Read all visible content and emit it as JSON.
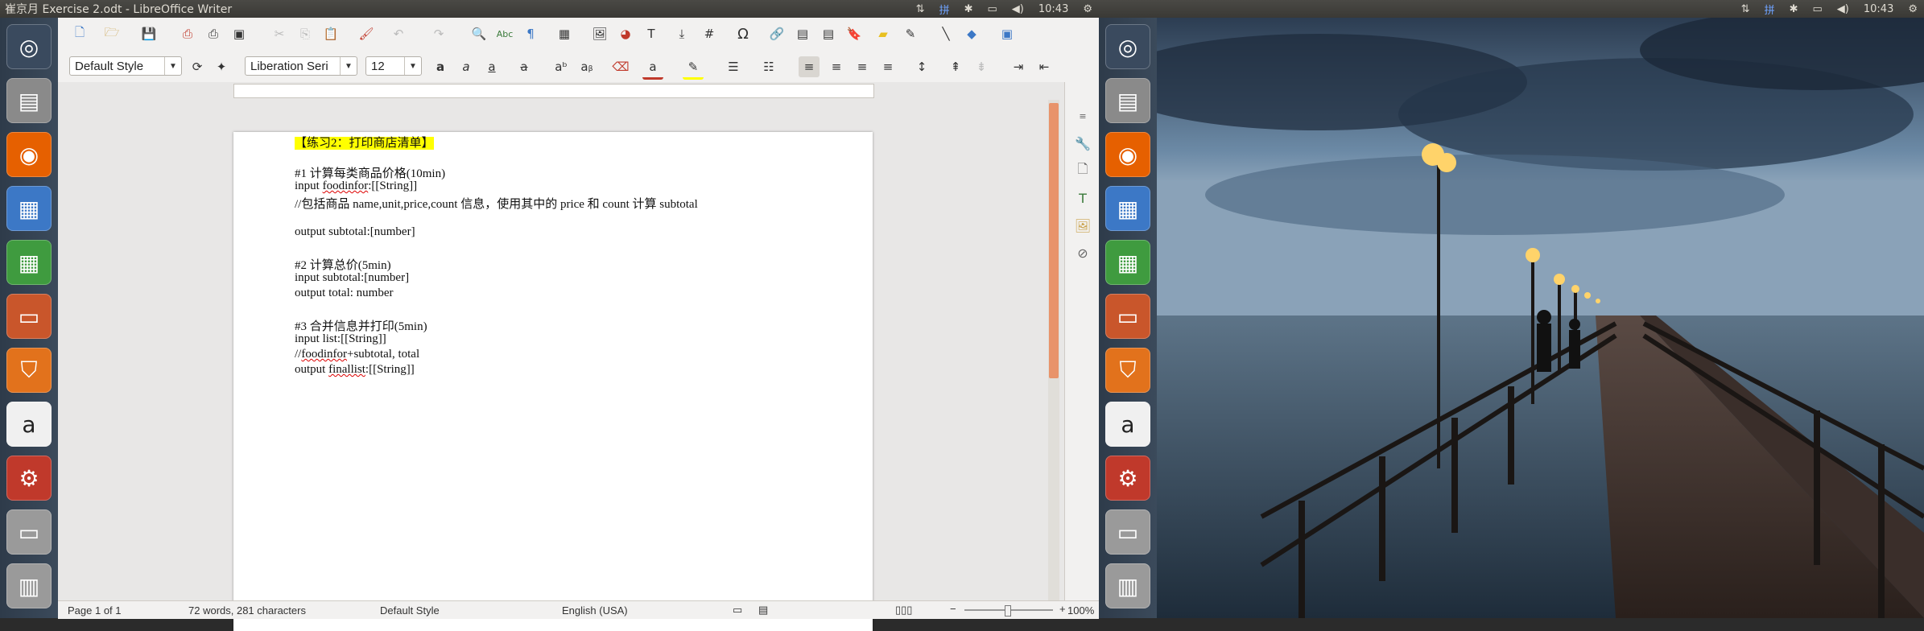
{
  "window": {
    "title": "崔京月 Exercise 2.odt - LibreOffice Writer"
  },
  "tray": {
    "time": "10:43"
  },
  "launcher": {
    "items": [
      {
        "name": "ubuntu-logo-icon",
        "glyph": "◎",
        "color": "#3a4a5e"
      },
      {
        "name": "files-icon",
        "glyph": "▤",
        "color": "#8a8a8a"
      },
      {
        "name": "firefox-icon",
        "glyph": "◉",
        "color": "#e66000"
      },
      {
        "name": "writer-icon",
        "glyph": "▦",
        "color": "#3c78c6"
      },
      {
        "name": "calc-icon",
        "glyph": "▦",
        "color": "#3f9b3f"
      },
      {
        "name": "impress-icon",
        "glyph": "▭",
        "color": "#c9562b"
      },
      {
        "name": "software-center-icon",
        "glyph": "⛉",
        "color": "#e2721c"
      },
      {
        "name": "amazon-icon",
        "glyph": "a",
        "color": "#f0f0f0"
      },
      {
        "name": "system-settings-icon",
        "glyph": "⚙",
        "color": "#c0392b"
      },
      {
        "name": "drive-icon",
        "glyph": "▭",
        "color": "#9a9a9a"
      },
      {
        "name": "trash-icon",
        "glyph": "▥",
        "color": "#9a9a9a"
      }
    ]
  },
  "formatting": {
    "paragraph_style": "Default Style",
    "font_name": "Liberation Seri",
    "font_size": "12"
  },
  "document": {
    "lines": [
      {
        "text": "【练习2：打印商店清单】",
        "highlight": true
      },
      {
        "text": ""
      },
      {
        "text": "#1 计算每类商品价格(10min)"
      },
      {
        "text": "input foodinfor:[[String]]"
      },
      {
        "text": "//包括商品 name,unit,price,count 信息，使用其中的 price 和 count 计算 subtotal"
      },
      {
        "text": ""
      },
      {
        "text": "output subtotal:[number]"
      },
      {
        "text": ""
      },
      {
        "text": "#2 计算总价(5min)"
      },
      {
        "text": "input subtotal:[number]"
      },
      {
        "text": "output total: number"
      },
      {
        "text": ""
      },
      {
        "text": "#3 合并信息并打印(5min)"
      },
      {
        "text": "input list:[[String]]"
      },
      {
        "text": "//foodinfor+subtotal, total"
      },
      {
        "text": "output finallist:[[String]]"
      }
    ]
  },
  "status": {
    "page": "Page 1 of 1",
    "words": "72 words, 281 characters",
    "style": "Default Style",
    "language": "English (USA)",
    "zoom": "100%"
  }
}
